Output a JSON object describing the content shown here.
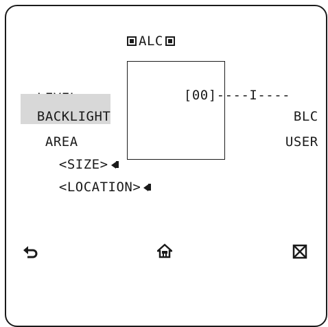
{
  "menu": {
    "title": "ALC",
    "title_icon": "filled-square-icon",
    "items": [
      {
        "label": "LEVEL",
        "value": "[00]----I----"
      },
      {
        "label": "BACKLIGHT",
        "value": "BLC",
        "selected": true
      },
      {
        "label": "AREA",
        "value": "USER"
      },
      {
        "label": "<SIZE>",
        "icon": "enter-icon"
      },
      {
        "label": "<LOCATION>",
        "icon": "enter-icon"
      }
    ]
  },
  "footer": {
    "back_icon": "back-arrow-icon",
    "home_icon": "home-icon",
    "close_icon": "close-box-icon"
  },
  "colors": {
    "foreground": "#1a1a1a",
    "highlight": "#d8d8d8",
    "background": "#ffffff"
  }
}
